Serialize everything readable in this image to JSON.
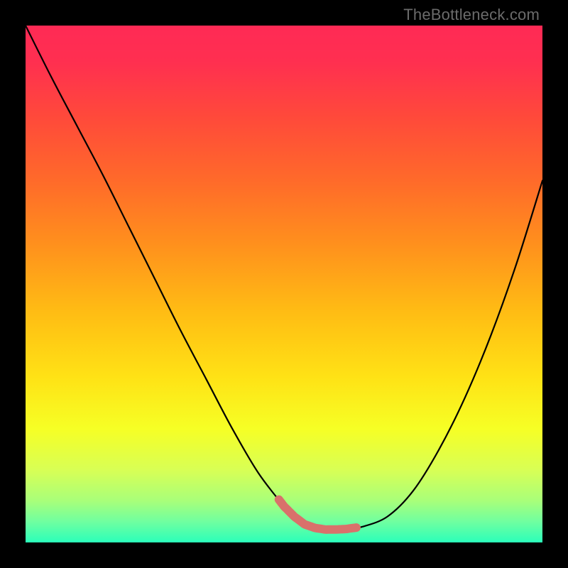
{
  "watermark": {
    "text": "TheBottleneck.com"
  },
  "colors": {
    "frame": "#000000",
    "curve_stroke": "#000000",
    "highlight_stroke": "#d9716b",
    "gradient_stops": [
      {
        "offset": 0.0,
        "color": "#ff2a55"
      },
      {
        "offset": 0.07,
        "color": "#ff2f50"
      },
      {
        "offset": 0.18,
        "color": "#ff4a3a"
      },
      {
        "offset": 0.3,
        "color": "#ff6a2a"
      },
      {
        "offset": 0.42,
        "color": "#ff8f1d"
      },
      {
        "offset": 0.55,
        "color": "#ffbb14"
      },
      {
        "offset": 0.68,
        "color": "#ffe215"
      },
      {
        "offset": 0.78,
        "color": "#f6ff25"
      },
      {
        "offset": 0.86,
        "color": "#d8ff55"
      },
      {
        "offset": 0.92,
        "color": "#a8ff7a"
      },
      {
        "offset": 0.96,
        "color": "#6fffa0"
      },
      {
        "offset": 1.0,
        "color": "#2bffba"
      }
    ]
  },
  "chart_data": {
    "type": "line",
    "title": "",
    "xlabel": "",
    "ylabel": "",
    "xlim": [
      0,
      100
    ],
    "ylim": [
      0,
      100
    ],
    "x": [
      0,
      5,
      10,
      15,
      20,
      25,
      30,
      35,
      40,
      45,
      50,
      52,
      54,
      56,
      58,
      60,
      62,
      65,
      70,
      75,
      80,
      85,
      90,
      95,
      100
    ],
    "series": [
      {
        "name": "bottleneck_curve",
        "values": [
          100,
          90,
          80.5,
          71,
          61,
          51,
          41,
          31.5,
          22,
          13.5,
          7,
          5,
          3.5,
          2.8,
          2.5,
          2.5,
          2.6,
          3,
          5,
          10,
          18,
          28,
          40,
          54,
          70
        ]
      }
    ],
    "highlight_range_x": [
      49,
      64
    ],
    "highlight_meaning": "optimal (no-bottleneck) zone near curve minimum"
  }
}
